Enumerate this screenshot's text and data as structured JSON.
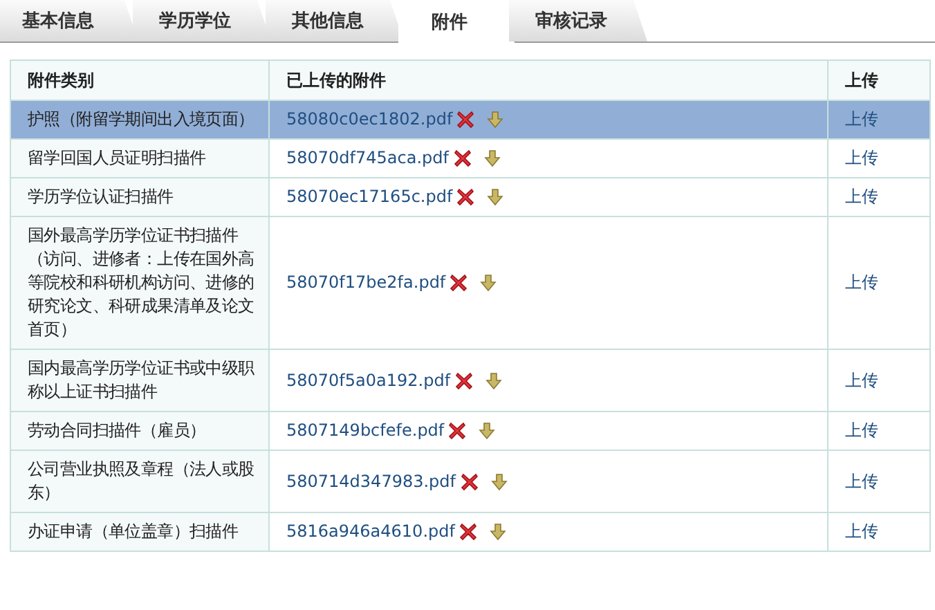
{
  "tabs": [
    {
      "label": "基本信息",
      "selected": false
    },
    {
      "label": "学历学位",
      "selected": false
    },
    {
      "label": "其他信息",
      "selected": false
    },
    {
      "label": "附件",
      "selected": true
    },
    {
      "label": "审核记录",
      "selected": false
    }
  ],
  "table": {
    "columns": [
      "附件类别",
      "已上传的附件",
      "上传"
    ],
    "rows": [
      {
        "category": "护照（附留学期间出入境页面）",
        "file": "58080c0ec1802.pdf",
        "action": "上传",
        "selected": true
      },
      {
        "category": "留学回国人员证明扫描件",
        "file": "58070df745aca.pdf",
        "action": "上传",
        "selected": false
      },
      {
        "category": "学历学位认证扫描件",
        "file": "58070ec17165c.pdf",
        "action": "上传",
        "selected": false
      },
      {
        "category": "国外最高学历学位证书扫描件（访问、进修者：上传在国外高等院校和科研机构访问、进修的研究论文、科研成果清单及论文首页）",
        "file": "58070f17be2fa.pdf",
        "action": "上传",
        "selected": false
      },
      {
        "category": "国内最高学历学位证书或中级职称以上证书扫描件",
        "file": "58070f5a0a192.pdf",
        "action": "上传",
        "selected": false
      },
      {
        "category": "劳动合同扫描件（雇员）",
        "file": "5807149bcfefe.pdf",
        "action": "上传",
        "selected": false
      },
      {
        "category": "公司营业执照及章程（法人或股东）",
        "file": "580714d347983.pdf",
        "action": "上传",
        "selected": false
      },
      {
        "category": "办证申请（单位盖章）扫描件",
        "file": "5816a946a4610.pdf",
        "action": "上传",
        "selected": false
      }
    ]
  }
}
